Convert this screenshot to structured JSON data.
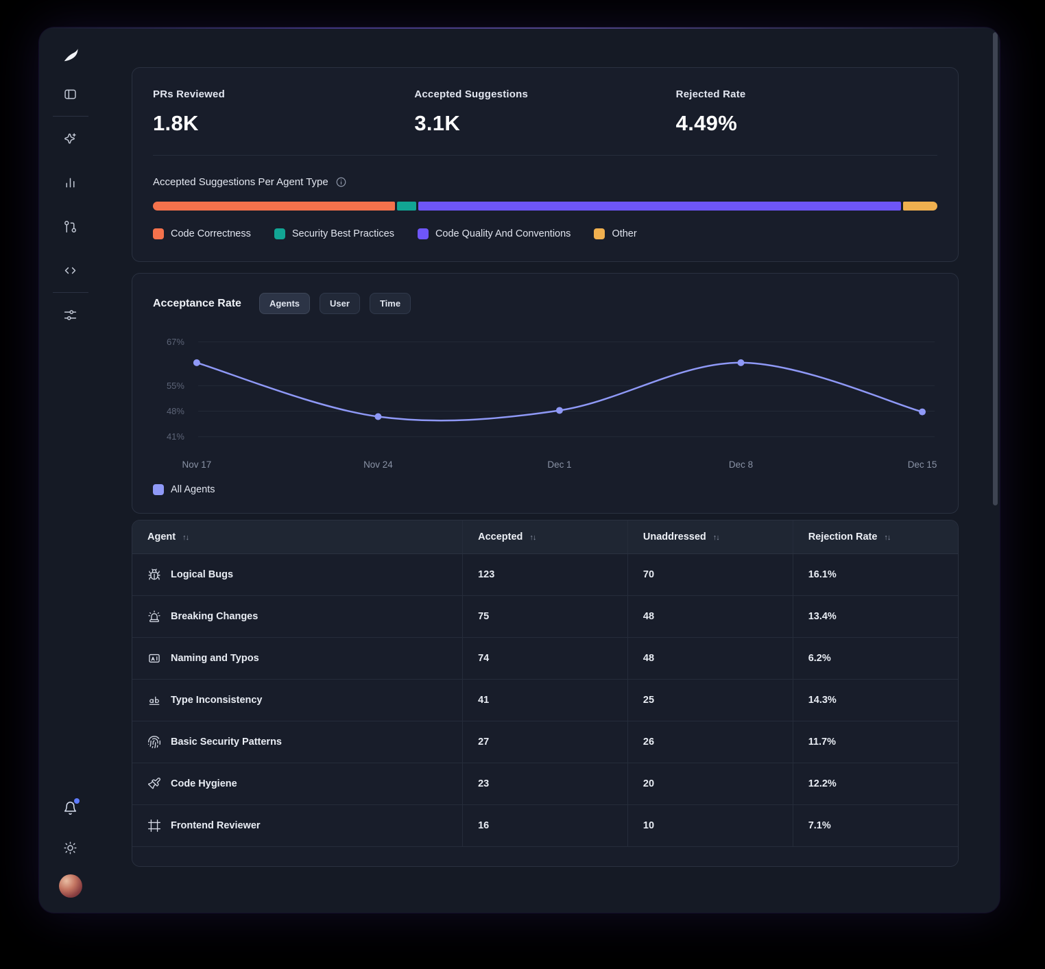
{
  "stats": {
    "items": [
      {
        "label": "PRs Reviewed",
        "value": "1.8K"
      },
      {
        "label": "Accepted Suggestions",
        "value": "3.1K"
      },
      {
        "label": "Rejected Rate",
        "value": "4.49%"
      }
    ],
    "breakdown": {
      "title": "Accepted Suggestions Per Agent Type",
      "segments": [
        {
          "label": "Code Correctness",
          "color": "#f4724c",
          "value": 31.1
        },
        {
          "label": "Security Best Practices",
          "color": "#12a594",
          "value": 2.5
        },
        {
          "label": "Code Quality And Conventions",
          "color": "#6e56f8",
          "value": 62.0
        },
        {
          "label": "Other",
          "color": "#f0b04f",
          "value": 4.4
        }
      ]
    }
  },
  "acceptance": {
    "title": "Acceptance Rate",
    "tabs": [
      {
        "label": "Agents",
        "selected": true
      },
      {
        "label": "User",
        "selected": false
      },
      {
        "label": "Time",
        "selected": false
      }
    ],
    "legend_items": [
      {
        "label": "All Agents",
        "color": "#8f99f7"
      }
    ]
  },
  "chart_data": {
    "type": "line",
    "title": "Acceptance Rate",
    "x": [
      "Nov 17",
      "Nov 24",
      "Dec 1",
      "Dec 8",
      "Dec 15"
    ],
    "series": [
      {
        "name": "All Agents",
        "values": [
          61.3,
          46.5,
          48.2,
          61.3,
          47.8
        ]
      }
    ],
    "yticks": [
      67,
      55,
      48,
      41
    ],
    "ytick_suffix": "%",
    "ylim": [
      40,
      69
    ],
    "grid": true,
    "line_color": "#8f99f7",
    "legend_position": "bottom"
  },
  "table": {
    "columns": [
      "Agent",
      "Accepted",
      "Unaddressed",
      "Rejection Rate"
    ],
    "sort_glyph": "↑↓",
    "rows": [
      {
        "icon": "bug",
        "agent": "Logical Bugs",
        "accepted": "123",
        "unaddressed": "70",
        "rejection": "16.1%"
      },
      {
        "icon": "siren",
        "agent": "Breaking Changes",
        "accepted": "75",
        "unaddressed": "48",
        "rejection": "13.4%"
      },
      {
        "icon": "letter",
        "agent": "Naming and Typos",
        "accepted": "74",
        "unaddressed": "48",
        "rejection": "6.2%"
      },
      {
        "icon": "type",
        "agent": "Type Inconsistency",
        "accepted": "41",
        "unaddressed": "25",
        "rejection": "14.3%"
      },
      {
        "icon": "fingerprint",
        "agent": "Basic Security Patterns",
        "accepted": "27",
        "unaddressed": "26",
        "rejection": "11.7%"
      },
      {
        "icon": "brush",
        "agent": "Code Hygiene",
        "accepted": "23",
        "unaddressed": "20",
        "rejection": "12.2%"
      },
      {
        "icon": "frame",
        "agent": "Frontend Reviewer",
        "accepted": "16",
        "unaddressed": "10",
        "rejection": "7.1%"
      }
    ]
  },
  "sidebar": {
    "icons": [
      "app-logo",
      "panel-toggle-icon",
      "sparkles-icon",
      "bar-chart-icon",
      "git-pull-request-icon",
      "code-icon",
      "settings-sliders-icon",
      "bell-icon",
      "theme-sun-icon",
      "user-avatar"
    ]
  }
}
